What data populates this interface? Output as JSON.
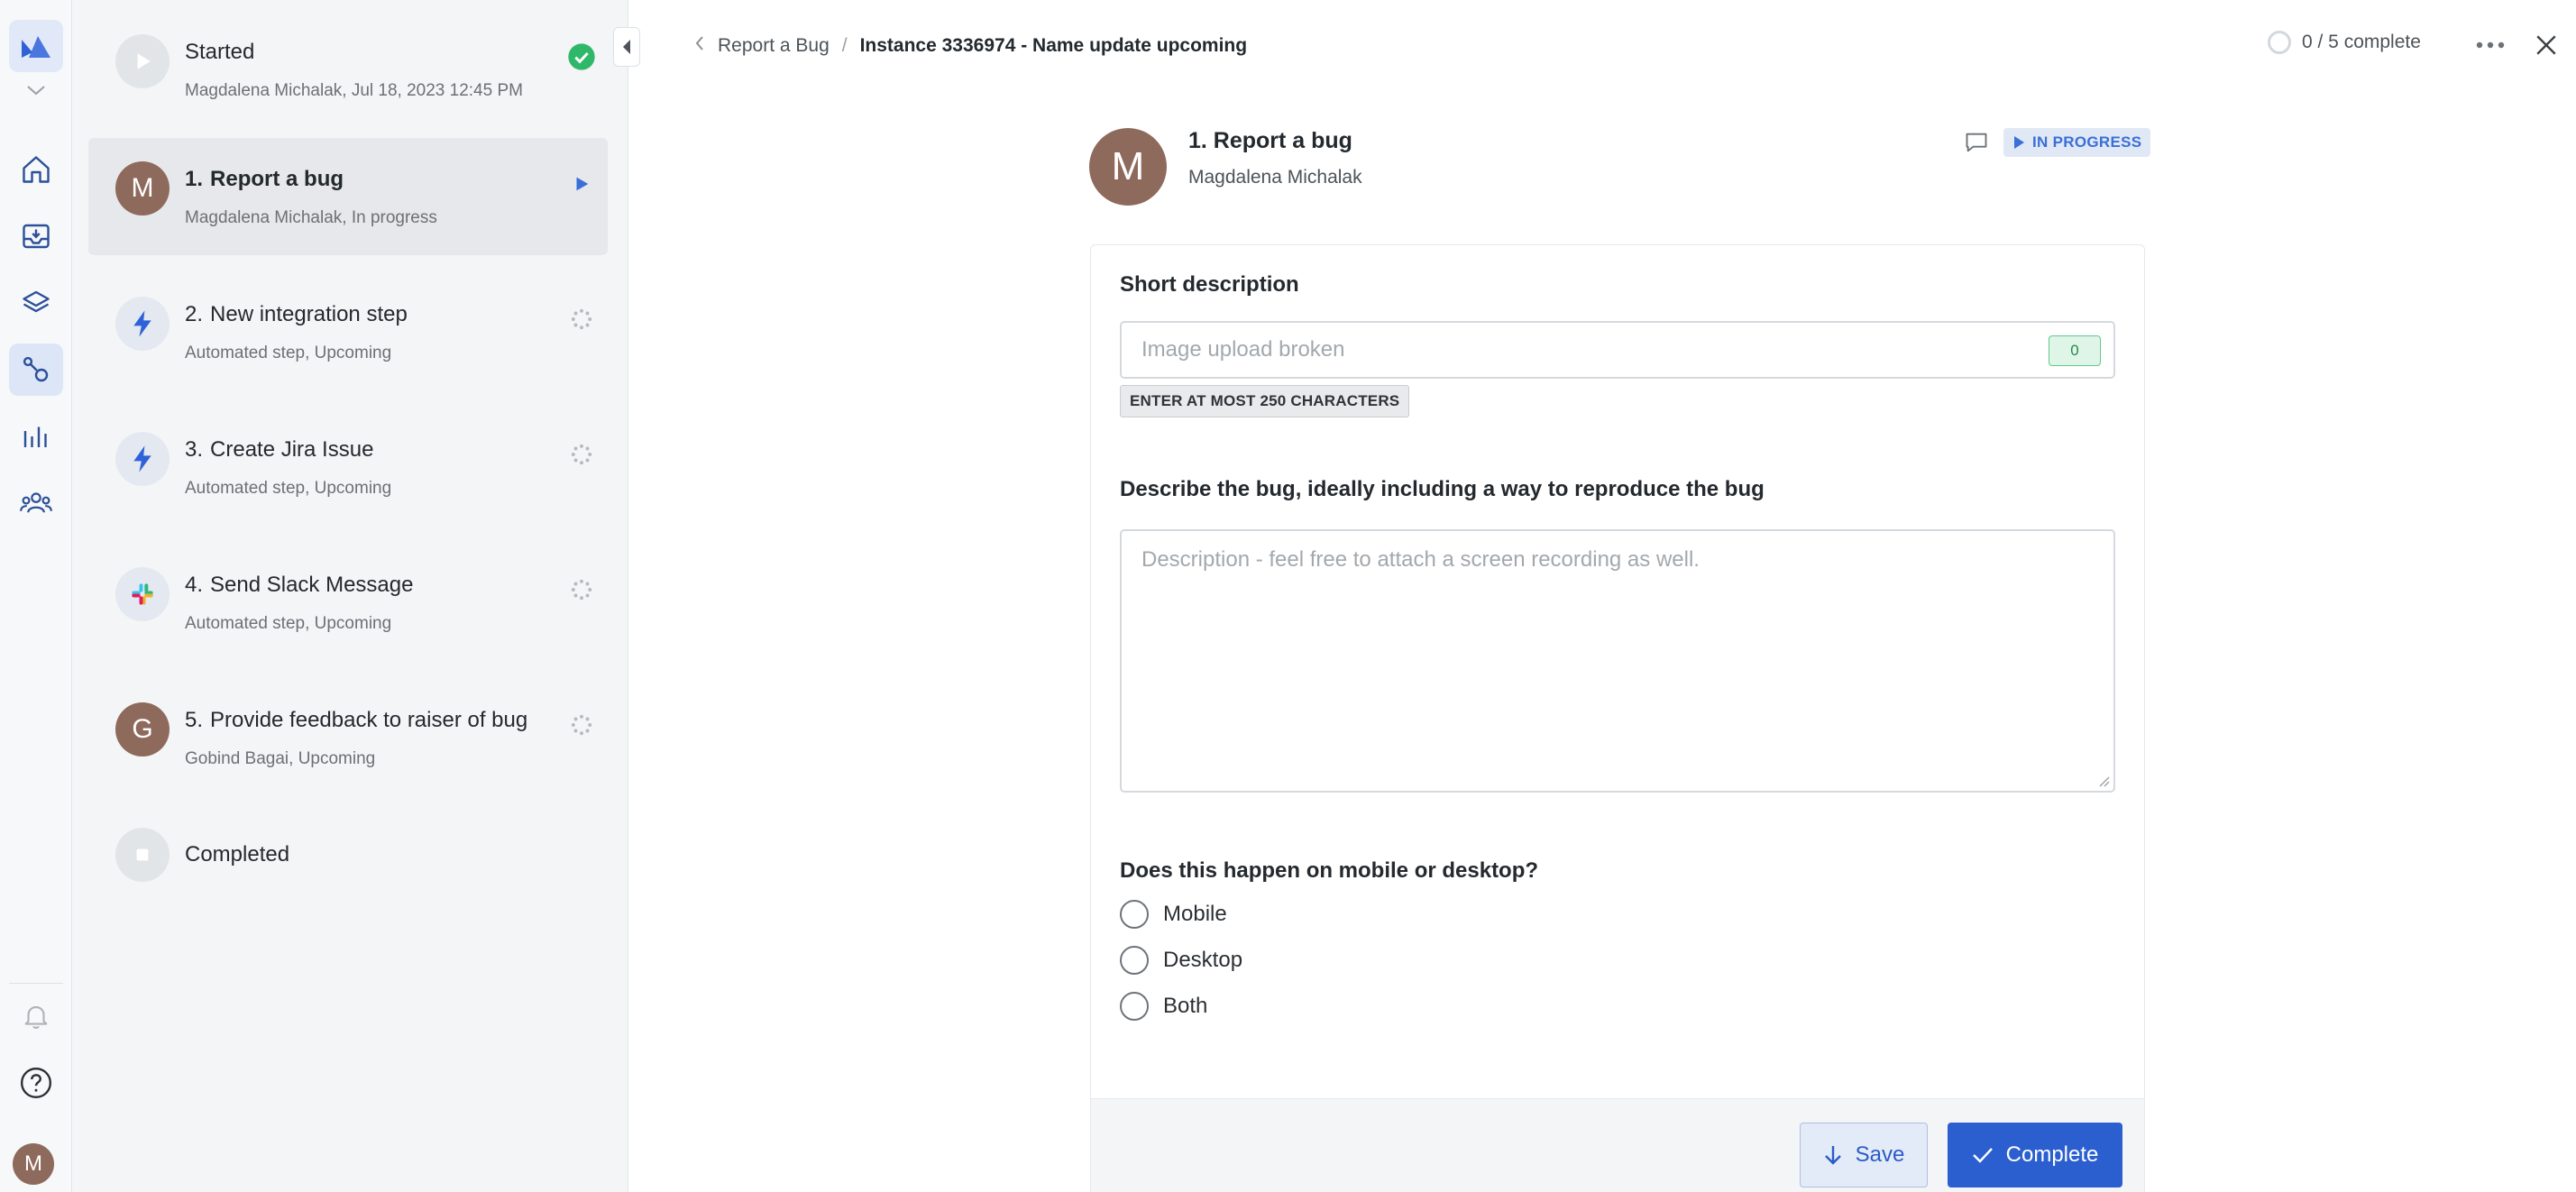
{
  "rail": {
    "nav_icons": [
      "logo-icon",
      "home-icon",
      "inbox-icon",
      "layers-icon",
      "workflow-icon",
      "reports-icon",
      "people-icon"
    ],
    "bottom_icons": [
      "bell-icon",
      "help-icon"
    ],
    "user_initial": "M"
  },
  "steps": {
    "started": {
      "title": "Started",
      "sub": "Magdalena Michalak, Jul 18, 2023 12:45 PM"
    },
    "items": [
      {
        "num": "1.",
        "title": "Report a bug",
        "sub": "Magdalena Michalak, In progress",
        "initial": "M",
        "state": "in-progress"
      },
      {
        "num": "2.",
        "title": "New integration step",
        "sub": "Automated step, Upcoming",
        "state": "upcoming"
      },
      {
        "num": "3.",
        "title": "Create Jira Issue",
        "sub": "Automated step, Upcoming",
        "state": "upcoming"
      },
      {
        "num": "4.",
        "title": "Send Slack Message",
        "sub": "Automated step, Upcoming",
        "state": "upcoming"
      },
      {
        "num": "5.",
        "title": "Provide feedback to raiser of bug",
        "sub": "Gobind Bagai, Upcoming",
        "initial": "G",
        "state": "upcoming"
      }
    ],
    "completed": {
      "title": "Completed"
    }
  },
  "breadcrumb": {
    "parent": "Report a Bug",
    "separator": "/",
    "current": "Instance 3336974 - Name update upcoming"
  },
  "progress": {
    "text": "0 / 5 complete"
  },
  "task": {
    "initial": "M",
    "title": "1. Report a bug",
    "assignee": "Magdalena Michalak",
    "status": "IN PROGRESS"
  },
  "form": {
    "short_description": {
      "label": "Short description",
      "placeholder": "Image upload broken",
      "value": "",
      "count": "0",
      "hint": "ENTER AT MOST 250 CHARACTERS"
    },
    "description": {
      "label": "Describe the bug, ideally including a way to reproduce the bug",
      "placeholder": "Description - feel free to attach a screen recording as well."
    },
    "platform": {
      "label": "Does this happen on mobile or desktop?",
      "options": [
        "Mobile",
        "Desktop",
        "Both"
      ]
    }
  },
  "footer": {
    "save_label": "Save",
    "complete_label": "Complete"
  },
  "colors": {
    "accent": "#2b5fd0",
    "success": "#2fb86a",
    "avatar": "#8e6a5c",
    "lightning": "#2f62d8"
  }
}
